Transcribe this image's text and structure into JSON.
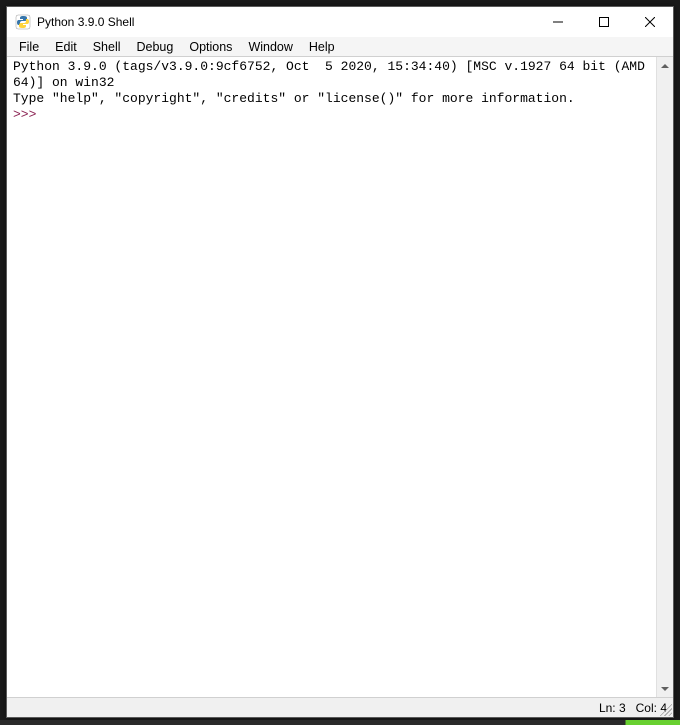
{
  "window": {
    "title": "Python 3.9.0 Shell"
  },
  "menu": {
    "items": [
      "File",
      "Edit",
      "Shell",
      "Debug",
      "Options",
      "Window",
      "Help"
    ]
  },
  "content": {
    "line1": "Python 3.9.0 (tags/v3.9.0:9cf6752, Oct  5 2020, 15:34:40) [MSC v.1927 64 bit (AMD64)] on win32",
    "line2": "Type \"help\", \"copyright\", \"credits\" or \"license()\" for more information.",
    "prompt": ">>> "
  },
  "status": {
    "text": "Ln: 3   Col: 4"
  }
}
